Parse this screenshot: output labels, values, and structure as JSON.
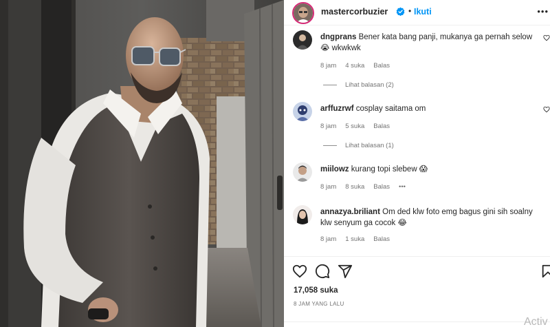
{
  "post": {
    "username": "mastercorbuzier",
    "follow_label": "Ikuti",
    "separator": "•",
    "more": "•••"
  },
  "comments": [
    {
      "username": "dngprans",
      "text": "Bener kata bang panji, mukanya ga pernah selow 😭 wkwkwk",
      "time": "8 jam",
      "likes": "4 suka",
      "reply_label": "Balas",
      "view_replies": "Lihat balasan (2)"
    },
    {
      "username": "arffuzrwf",
      "text": "cosplay saitama om",
      "time": "8 jam",
      "likes": "5 suka",
      "reply_label": "Balas",
      "view_replies": "Lihat balasan (1)"
    },
    {
      "username": "miilowz",
      "text": "kurang topi slebew 😱",
      "time": "8 jam",
      "likes": "8 suka",
      "reply_label": "Balas",
      "more": "•••"
    },
    {
      "username": "annazya.briliant",
      "text": "Om ded klw foto emg bagus gini sih soalny klw senyum ga cocok 😂",
      "time": "8 jam",
      "likes": "1 suka",
      "reply_label": "Balas"
    }
  ],
  "actions": {
    "like_icon": "heart-icon",
    "comment_icon": "comment-icon",
    "share_icon": "send-icon",
    "save_icon": "bookmark-icon",
    "likes_count": "17,058 suka",
    "time_ago": "8 JAM YANG LALU"
  },
  "watermark": "Activ",
  "colors": {
    "link_blue": "#0095f6",
    "verified_blue": "#0095f6",
    "text": "#262626",
    "meta": "#737373"
  }
}
